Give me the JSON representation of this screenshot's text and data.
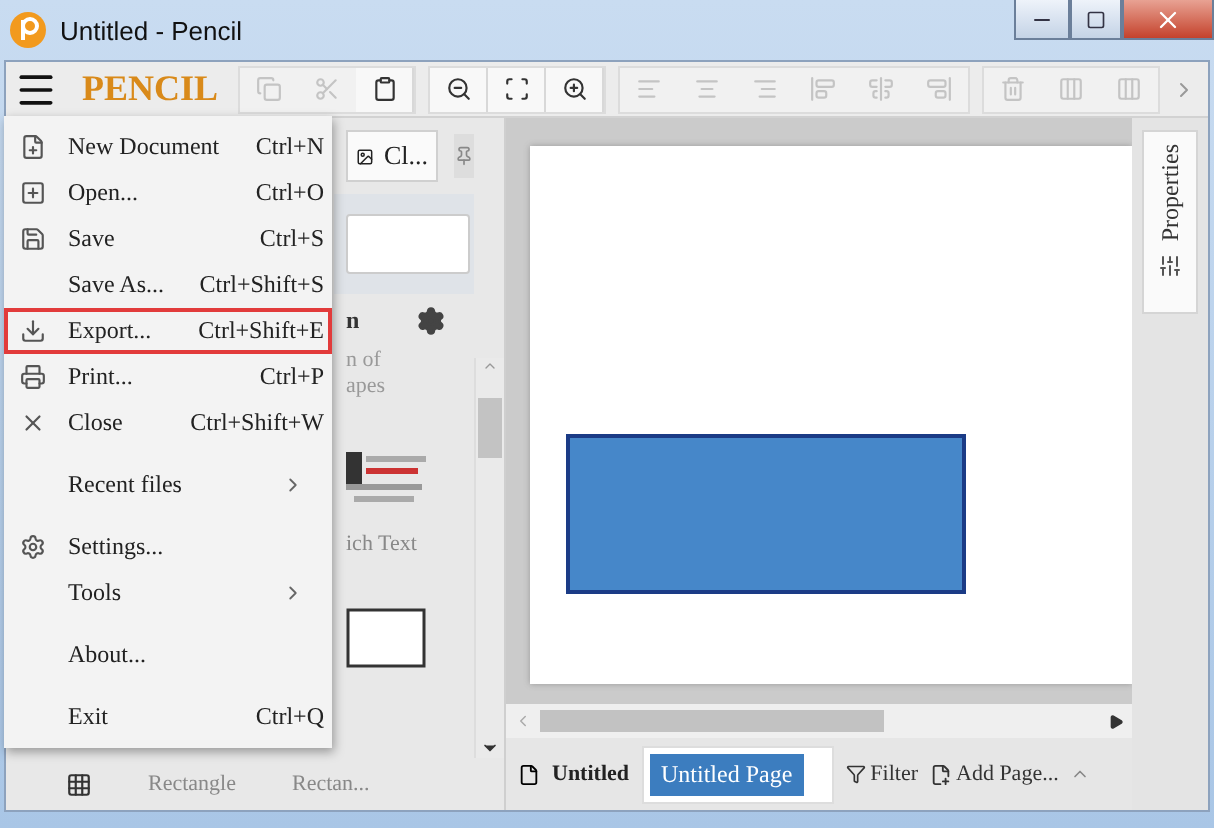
{
  "window": {
    "title": "Untitled - Pencil"
  },
  "toolbar": {
    "logo": "PENCIL",
    "groups": [
      {
        "buttons": [
          {
            "disabled": true
          },
          {
            "disabled": true
          },
          {
            "disabled": false
          }
        ]
      },
      {
        "buttons": [
          {
            "disabled": false
          },
          {
            "disabled": false
          },
          {
            "disabled": false
          }
        ]
      },
      {
        "buttons": [
          {
            "disabled": true
          },
          {
            "disabled": true
          },
          {
            "disabled": true
          },
          {
            "disabled": true
          },
          {
            "disabled": true
          },
          {
            "disabled": true
          }
        ]
      },
      {
        "buttons": [
          {
            "disabled": true
          },
          {
            "disabled": true
          },
          {
            "disabled": true
          }
        ]
      }
    ]
  },
  "shapes_panel": {
    "collection_button": "Cl...",
    "heading": "n",
    "description": [
      "n of",
      "apes"
    ],
    "shapes": [
      {
        "label": "ich Text"
      },
      {
        "label": "Rectangle"
      },
      {
        "label": "Rectan..."
      }
    ]
  },
  "menu": {
    "groups": [
      [
        {
          "label": "New Document",
          "shortcut": "Ctrl+N",
          "highlighted": false
        },
        {
          "label": "Open...",
          "shortcut": "Ctrl+O",
          "highlighted": false
        },
        {
          "label": "Save",
          "shortcut": "Ctrl+S",
          "highlighted": false
        },
        {
          "label": "Save As...",
          "shortcut": "Ctrl+Shift+S",
          "highlighted": false
        },
        {
          "label": "Export...",
          "shortcut": "Ctrl+Shift+E",
          "highlighted": true
        },
        {
          "label": "Print...",
          "shortcut": "Ctrl+P",
          "highlighted": false
        },
        {
          "label": "Close",
          "shortcut": "Ctrl+Shift+W",
          "highlighted": false
        }
      ],
      [
        {
          "label": "Recent files",
          "submenu": true,
          "highlighted": false
        }
      ],
      [
        {
          "label": "Settings...",
          "highlighted": false
        },
        {
          "label": "Tools",
          "submenu": true,
          "highlighted": false
        }
      ],
      [
        {
          "label": "About...",
          "highlighted": false
        }
      ],
      [
        {
          "label": "Exit",
          "shortcut": "Ctrl+Q",
          "highlighted": false
        }
      ]
    ]
  },
  "properties_tab": "Properties",
  "pages_bar": {
    "document": "Untitled",
    "pages": [
      {
        "label": "Untitled Page",
        "selected": true
      }
    ],
    "filter": "Filter",
    "add_page": "Add Page..."
  }
}
